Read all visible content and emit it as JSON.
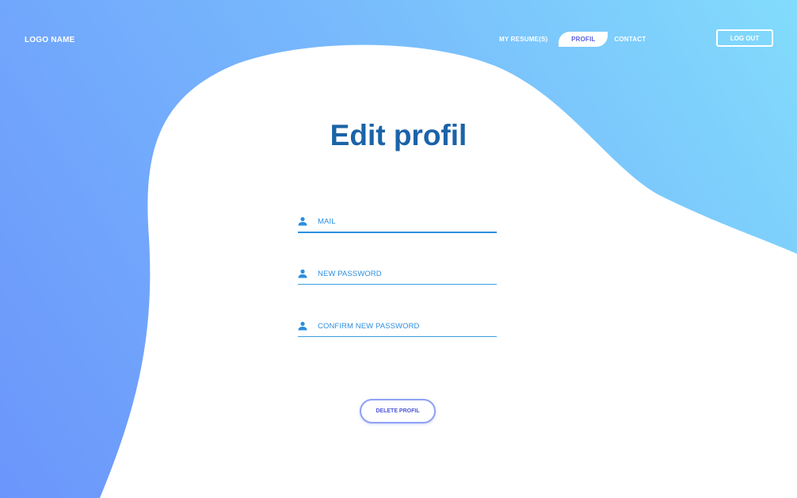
{
  "header": {
    "logo": "LOGO NAME",
    "nav": {
      "resume": "MY RESUME(S)",
      "profil": "PROFIL",
      "contact": "CONTACT"
    },
    "logout": "LOG OUT"
  },
  "main": {
    "title": "Edit profil",
    "fields": [
      {
        "label": "MAIL",
        "icon": "user-icon"
      },
      {
        "label": "NEW PASSWORD",
        "icon": "user-icon"
      },
      {
        "label": "CONFIRM NEW PASSWORD",
        "icon": "user-icon"
      }
    ],
    "delete_button": "DELETE PROFIL"
  },
  "colors": {
    "gradient_start": "#6b95fb",
    "gradient_end": "#82dcfc",
    "title": "#1b63a8",
    "field_accent": "#2b8ee0",
    "button_text": "#4c55d8"
  }
}
